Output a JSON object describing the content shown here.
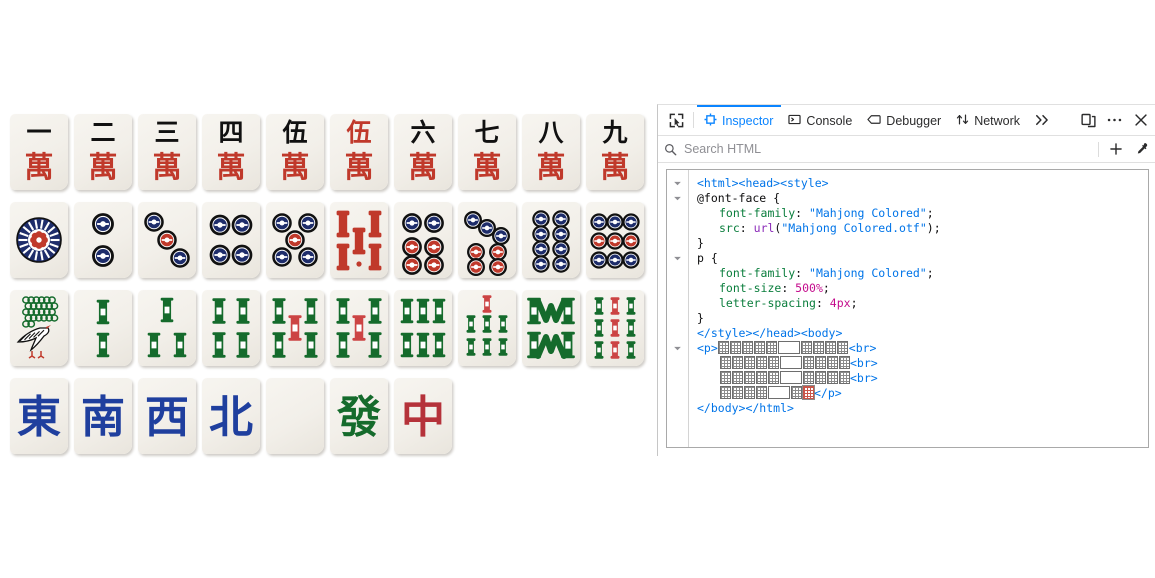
{
  "page": {
    "tile_rows": [
      {
        "suit": "characters",
        "tiles": [
          {
            "name": "tile-man-1",
            "label": "一萬",
            "kind": "man",
            "rank": 1,
            "red": false
          },
          {
            "name": "tile-man-2",
            "label": "二萬",
            "kind": "man",
            "rank": 2,
            "red": false
          },
          {
            "name": "tile-man-3",
            "label": "三萬",
            "kind": "man",
            "rank": 3,
            "red": false
          },
          {
            "name": "tile-man-4",
            "label": "四萬",
            "kind": "man",
            "rank": 4,
            "red": false
          },
          {
            "name": "tile-man-5",
            "label": "伍萬",
            "kind": "man",
            "rank": 5,
            "red": false
          },
          {
            "name": "tile-man-5-red",
            "label": "伍萬 (red five)",
            "kind": "man",
            "rank": 5,
            "red": true
          },
          {
            "name": "tile-man-6",
            "label": "六萬",
            "kind": "man",
            "rank": 6,
            "red": false
          },
          {
            "name": "tile-man-7",
            "label": "七萬",
            "kind": "man",
            "rank": 7,
            "red": false
          },
          {
            "name": "tile-man-8",
            "label": "八萬",
            "kind": "man",
            "rank": 8,
            "red": false
          },
          {
            "name": "tile-man-9",
            "label": "九萬",
            "kind": "man",
            "rank": 9,
            "red": false
          }
        ]
      },
      {
        "suit": "circles",
        "tiles": [
          {
            "name": "tile-pin-1",
            "label": "1 Circle",
            "kind": "pin",
            "rank": 1,
            "red": false
          },
          {
            "name": "tile-pin-2",
            "label": "2 Circles",
            "kind": "pin",
            "rank": 2,
            "red": false
          },
          {
            "name": "tile-pin-3",
            "label": "3 Circles",
            "kind": "pin",
            "rank": 3,
            "red": false
          },
          {
            "name": "tile-pin-4",
            "label": "4 Circles",
            "kind": "pin",
            "rank": 4,
            "red": false
          },
          {
            "name": "tile-pin-5",
            "label": "5 Circles",
            "kind": "pin",
            "rank": 5,
            "red": false
          },
          {
            "name": "tile-pin-5-red",
            "label": "5 Circles (red five)",
            "kind": "pin",
            "rank": 5,
            "red": true
          },
          {
            "name": "tile-pin-6",
            "label": "6 Circles",
            "kind": "pin",
            "rank": 6,
            "red": false
          },
          {
            "name": "tile-pin-7",
            "label": "7 Circles",
            "kind": "pin",
            "rank": 7,
            "red": false
          },
          {
            "name": "tile-pin-8",
            "label": "8 Circles",
            "kind": "pin",
            "rank": 8,
            "red": false
          },
          {
            "name": "tile-pin-9",
            "label": "9 Circles",
            "kind": "pin",
            "rank": 9,
            "red": false
          }
        ]
      },
      {
        "suit": "bamboo",
        "tiles": [
          {
            "name": "tile-sou-1",
            "label": "1 Bamboo (sparrow)",
            "kind": "sou",
            "rank": 1,
            "red": false
          },
          {
            "name": "tile-sou-2",
            "label": "2 Bamboo",
            "kind": "sou",
            "rank": 2,
            "red": false
          },
          {
            "name": "tile-sou-3",
            "label": "3 Bamboo",
            "kind": "sou",
            "rank": 3,
            "red": false
          },
          {
            "name": "tile-sou-4",
            "label": "4 Bamboo",
            "kind": "sou",
            "rank": 4,
            "red": false
          },
          {
            "name": "tile-sou-5",
            "label": "5 Bamboo",
            "kind": "sou",
            "rank": 5,
            "red": false
          },
          {
            "name": "tile-sou-5-red",
            "label": "5 Bamboo (red five)",
            "kind": "sou",
            "rank": 5,
            "red": true
          },
          {
            "name": "tile-sou-6",
            "label": "6 Bamboo",
            "kind": "sou",
            "rank": 6,
            "red": false
          },
          {
            "name": "tile-sou-7",
            "label": "7 Bamboo",
            "kind": "sou",
            "rank": 7,
            "red": false
          },
          {
            "name": "tile-sou-8",
            "label": "8 Bamboo",
            "kind": "sou",
            "rank": 8,
            "red": false
          },
          {
            "name": "tile-sou-9",
            "label": "9 Bamboo",
            "kind": "sou",
            "rank": 9,
            "red": false
          }
        ]
      },
      {
        "suit": "honors",
        "tiles": [
          {
            "name": "tile-wind-east",
            "label": "東",
            "kind": "honor",
            "rank": 0,
            "red": false
          },
          {
            "name": "tile-wind-south",
            "label": "南",
            "kind": "honor",
            "rank": 0,
            "red": false
          },
          {
            "name": "tile-wind-west",
            "label": "西",
            "kind": "honor",
            "rank": 0,
            "red": false
          },
          {
            "name": "tile-wind-north",
            "label": "北",
            "kind": "honor",
            "rank": 0,
            "red": false
          },
          {
            "name": "tile-dragon-white",
            "label": "White Dragon (blank)",
            "kind": "blank",
            "rank": 0,
            "red": false
          },
          {
            "name": "tile-dragon-green",
            "label": "發",
            "kind": "honor",
            "rank": 0,
            "red": false
          },
          {
            "name": "tile-dragon-red",
            "label": "中",
            "kind": "honor",
            "rank": 0,
            "red": false
          }
        ]
      }
    ]
  },
  "devtools": {
    "toolbar": {
      "picker_icon": "element-picker-icon",
      "tabs": [
        {
          "name": "tab-inspector",
          "label": "Inspector",
          "icon": "inspector-icon",
          "active": true
        },
        {
          "name": "tab-console",
          "label": "Console",
          "icon": "console-icon",
          "active": false
        },
        {
          "name": "tab-debugger",
          "label": "Debugger",
          "icon": "debugger-icon",
          "active": false
        },
        {
          "name": "tab-network",
          "label": "Network",
          "icon": "network-icon",
          "active": false
        }
      ],
      "overflow_icon": "chevron-double-right-icon",
      "responsive_icon": "responsive-design-mode-icon",
      "meatball_icon": "meatball-menu-icon",
      "close_icon": "close-icon"
    },
    "search": {
      "placeholder": "Search HTML",
      "value": "",
      "icon": "search-icon",
      "add_node_icon": "plus-icon",
      "eyedropper_icon": "eyedropper-icon"
    },
    "markup": {
      "lines": [
        {
          "id": "l1",
          "twisty": true,
          "indent": 0,
          "tokens": [
            {
              "t": "tag",
              "v": "<html><head><style>"
            }
          ]
        },
        {
          "id": "l2",
          "twisty": true,
          "indent": 0,
          "tokens": [
            {
              "t": "atrule",
              "v": "@font-face {"
            }
          ]
        },
        {
          "id": "l3",
          "twisty": false,
          "indent": 1,
          "tokens": [
            {
              "t": "prop",
              "v": "font-family"
            },
            {
              "t": "punc",
              "v": ": "
            },
            {
              "t": "str",
              "v": "\"Mahjong Colored\""
            },
            {
              "t": "punc",
              "v": ";"
            }
          ]
        },
        {
          "id": "l4",
          "twisty": false,
          "indent": 1,
          "tokens": [
            {
              "t": "prop",
              "v": "src"
            },
            {
              "t": "punc",
              "v": ": "
            },
            {
              "t": "fn",
              "v": "url"
            },
            {
              "t": "punc",
              "v": "("
            },
            {
              "t": "str",
              "v": "\"Mahjong Colored.otf\""
            },
            {
              "t": "punc",
              "v": ");"
            }
          ]
        },
        {
          "id": "l5",
          "twisty": false,
          "indent": 0,
          "tokens": [
            {
              "t": "punc",
              "v": "}"
            }
          ]
        },
        {
          "id": "l6",
          "twisty": true,
          "indent": 0,
          "tokens": [
            {
              "t": "sel",
              "v": "p {"
            }
          ]
        },
        {
          "id": "l7",
          "twisty": false,
          "indent": 1,
          "tokens": [
            {
              "t": "prop",
              "v": "font-family"
            },
            {
              "t": "punc",
              "v": ": "
            },
            {
              "t": "str",
              "v": "\"Mahjong Colored\""
            },
            {
              "t": "punc",
              "v": ";"
            }
          ]
        },
        {
          "id": "l8",
          "twisty": false,
          "indent": 1,
          "tokens": [
            {
              "t": "prop",
              "v": "font-size"
            },
            {
              "t": "punc",
              "v": ": "
            },
            {
              "t": "num",
              "v": "500%"
            },
            {
              "t": "punc",
              "v": ";"
            }
          ]
        },
        {
          "id": "l9",
          "twisty": false,
          "indent": 1,
          "tokens": [
            {
              "t": "prop",
              "v": "letter-spacing"
            },
            {
              "t": "punc",
              "v": ": "
            },
            {
              "t": "num",
              "v": "4px"
            },
            {
              "t": "punc",
              "v": ";"
            }
          ]
        },
        {
          "id": "l10",
          "twisty": false,
          "indent": 0,
          "tokens": [
            {
              "t": "punc",
              "v": "}"
            }
          ]
        },
        {
          "id": "l11",
          "twisty": false,
          "indent": 0,
          "tokens": [
            {
              "t": "tag",
              "v": "</style></head><body>"
            }
          ]
        },
        {
          "id": "l12",
          "twisty": true,
          "indent": 0,
          "tokens": [
            {
              "t": "tag",
              "v": "<p>"
            },
            {
              "t": "tofu",
              "v": "5"
            },
            {
              "t": "tofu-wide",
              "v": "1"
            },
            {
              "t": "tofu",
              "v": "4"
            },
            {
              "t": "tag",
              "v": "<br>"
            }
          ]
        },
        {
          "id": "l13",
          "twisty": false,
          "indent": 1,
          "tokens": [
            {
              "t": "tofu",
              "v": "5"
            },
            {
              "t": "tofu-wide",
              "v": "1"
            },
            {
              "t": "tofu",
              "v": "4"
            },
            {
              "t": "tag",
              "v": "<br>"
            }
          ]
        },
        {
          "id": "l14",
          "twisty": false,
          "indent": 1,
          "tokens": [
            {
              "t": "tofu",
              "v": "5"
            },
            {
              "t": "tofu-wide",
              "v": "1"
            },
            {
              "t": "tofu",
              "v": "4"
            },
            {
              "t": "tag",
              "v": "<br>"
            }
          ]
        },
        {
          "id": "l15",
          "twisty": false,
          "indent": 1,
          "tokens": [
            {
              "t": "tofu",
              "v": "4"
            },
            {
              "t": "tofu-wide",
              "v": "1"
            },
            {
              "t": "tofu",
              "v": "1"
            },
            {
              "t": "tofu-red",
              "v": "1"
            },
            {
              "t": "tag",
              "v": "</p>"
            }
          ]
        },
        {
          "id": "l16",
          "twisty": false,
          "indent": 0,
          "tokens": [
            {
              "t": "tag",
              "v": "</body></html>"
            }
          ]
        }
      ]
    }
  },
  "colors": {
    "accent": "#0a84ff",
    "tile_face": "#f2efe9",
    "man_red": "#c0392b",
    "man_black": "#111111",
    "pin_navy": "#1e2d6b",
    "pin_red": "#c0392b",
    "sou_green": "#156b2c",
    "sou_red": "#cc4444",
    "wind_blue": "#1f3f9e",
    "dragon_green": "#156b2c",
    "dragon_red": "#b5323a",
    "code_tag": "#0074e8",
    "code_prop": "#0b7e3d",
    "code_num": "#c40b8c",
    "code_fn": "#8b2bb9"
  }
}
